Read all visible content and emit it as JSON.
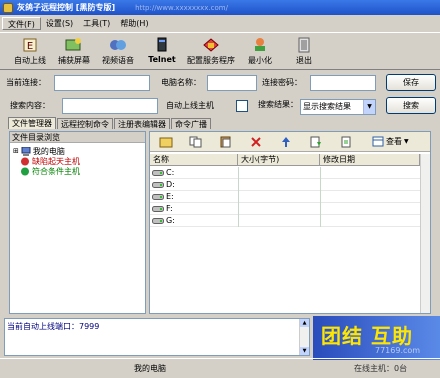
{
  "window": {
    "title": "灰鸽子远程控制 [黑防专版]",
    "url_fragment": "http://www.xxxxxxxx.com/"
  },
  "menu": [
    "文件(F)",
    "设置(S)",
    "工具(T)",
    "帮助(H)"
  ],
  "toolbar": [
    {
      "label": "自动上线",
      "icon": "auto-online-icon"
    },
    {
      "label": "捕获屏幕",
      "icon": "capture-screen-icon"
    },
    {
      "label": "视频语音",
      "icon": "video-voice-icon"
    },
    {
      "label": "Telnet",
      "icon": "telnet-icon"
    },
    {
      "label": "配置服务程序",
      "icon": "config-service-icon"
    },
    {
      "label": "最小化",
      "icon": "minimize-icon"
    },
    {
      "label": "退出",
      "icon": "exit-icon"
    }
  ],
  "connect": {
    "current_label": "当前连接：",
    "current_value": "",
    "computer_name_label": "电脑名称：",
    "computer_name_value": "",
    "password_label": "连接密码：",
    "password_value": "",
    "save_label": "保存"
  },
  "search": {
    "content_label": "搜索内容：",
    "content_value": "",
    "auto_online_label": "自动上线主机",
    "result_label": "搜索结果：",
    "result_option": "显示搜索结果",
    "search_button": "搜索"
  },
  "tabs": [
    "文件管理器",
    "远程控制命令",
    "注册表编辑器",
    "命令广播"
  ],
  "tree": {
    "header": "文件目录浏览",
    "nodes": [
      {
        "label": "我的电脑",
        "color": "#000000"
      },
      {
        "label": "缺陷起天主机",
        "color": "#c00000"
      },
      {
        "label": "符合条件主机",
        "color": "#008000"
      }
    ]
  },
  "file_toolbar": {
    "view_label": "查看"
  },
  "files": {
    "columns": [
      "名称",
      "大小(字节)",
      "修改日期"
    ],
    "rows": [
      {
        "name": "C:"
      },
      {
        "name": "D:"
      },
      {
        "name": "E:"
      },
      {
        "name": "F:"
      },
      {
        "name": "G:"
      }
    ]
  },
  "log": {
    "text": "当前自动上线端口：7999"
  },
  "banner": {
    "text": "团结 互助",
    "sub": "77169.com"
  },
  "status": {
    "center": "我的电脑",
    "right": "在线主机：0台"
  }
}
